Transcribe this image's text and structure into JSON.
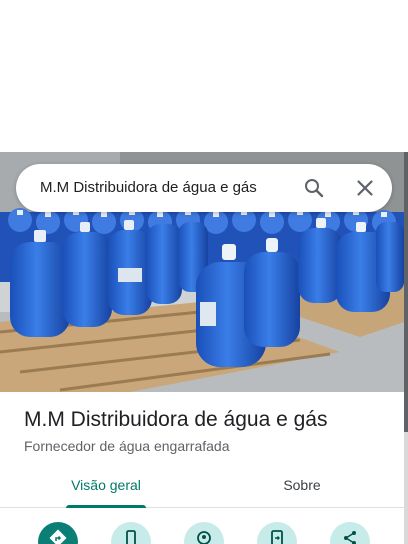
{
  "search": {
    "query": "M.M Distribuidora de água e gás"
  },
  "place": {
    "title": "M.M Distribuidora de água e gás",
    "category": "Fornecedor de água engarrafada"
  },
  "tabs": [
    {
      "label": "Visão geral",
      "active": true
    },
    {
      "label": "Sobre",
      "active": false
    }
  ],
  "colors": {
    "accent": "#00796b",
    "primary_action": "#0b7f75",
    "secondary_action": "#c7ebe8",
    "jug_blue": "#1e5fd0"
  },
  "actions": [
    {
      "icon": "directions-icon"
    },
    {
      "icon": "phone-icon"
    },
    {
      "icon": "nearby-icon"
    },
    {
      "icon": "send-to-phone-icon"
    },
    {
      "icon": "share-icon"
    }
  ]
}
